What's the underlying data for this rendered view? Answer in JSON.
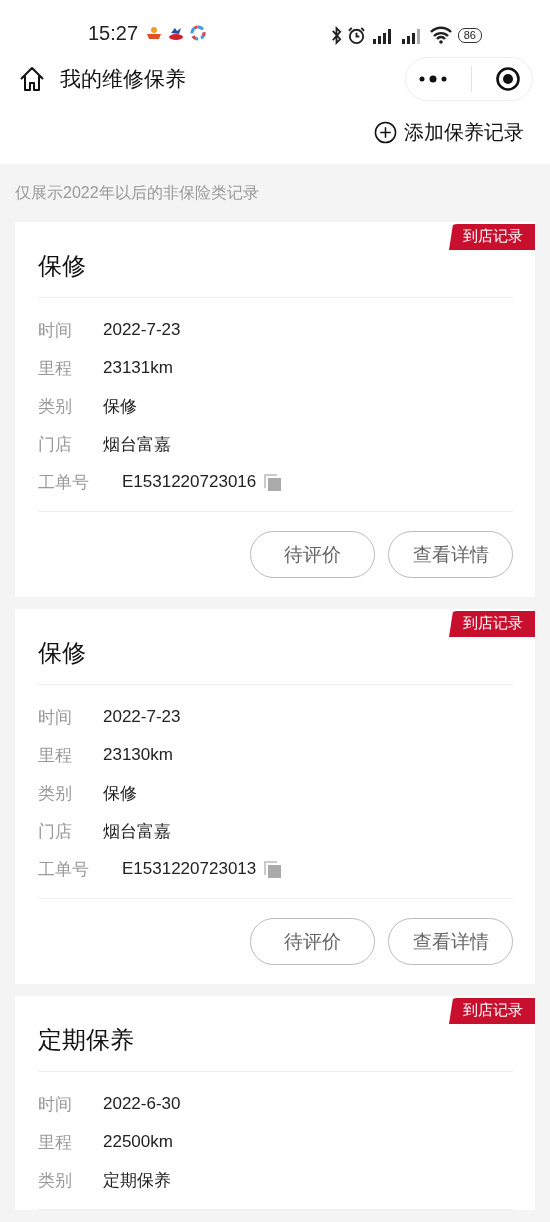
{
  "status_bar": {
    "time": "15:27",
    "battery": "86"
  },
  "nav": {
    "title": "我的维修保养"
  },
  "add_button": {
    "label": "添加保养记录"
  },
  "notice": "仅展示2022年以后的非保险类记录",
  "records": [
    {
      "badge": "到店记录",
      "title": "保修",
      "fields": [
        {
          "kind": "text",
          "label": "时间",
          "value": "2022-7-23"
        },
        {
          "kind": "text",
          "label": "里程",
          "value": "23131km"
        },
        {
          "kind": "text",
          "label": "类别",
          "value": "保修"
        },
        {
          "kind": "text",
          "label": "门店",
          "value": "烟台富嘉"
        },
        {
          "kind": "copyable",
          "label": "工单号",
          "value": "E1531220723016"
        }
      ],
      "buttons": [
        "待评价",
        "查看详情"
      ]
    },
    {
      "badge": "到店记录",
      "title": "保修",
      "fields": [
        {
          "kind": "text",
          "label": "时间",
          "value": "2022-7-23"
        },
        {
          "kind": "text",
          "label": "里程",
          "value": "23130km"
        },
        {
          "kind": "text",
          "label": "类别",
          "value": "保修"
        },
        {
          "kind": "text",
          "label": "门店",
          "value": "烟台富嘉"
        },
        {
          "kind": "copyable",
          "label": "工单号",
          "value": "E1531220723013"
        }
      ],
      "buttons": [
        "待评价",
        "查看详情"
      ]
    },
    {
      "badge": "到店记录",
      "title": "定期保养",
      "fields": [
        {
          "kind": "text",
          "label": "时间",
          "value": "2022-6-30"
        },
        {
          "kind": "text",
          "label": "里程",
          "value": "22500km"
        },
        {
          "kind": "text",
          "label": "类别",
          "value": "定期保养"
        }
      ]
    }
  ]
}
